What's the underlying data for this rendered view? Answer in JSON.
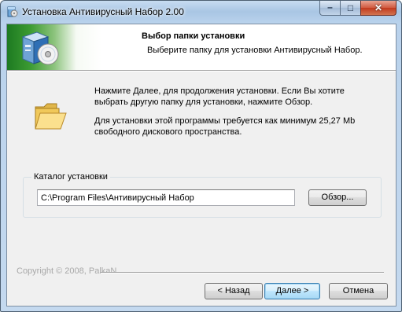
{
  "window": {
    "title": "Установка Антивирусный Набор 2.00",
    "minimize_glyph": "–",
    "maximize_glyph": "□",
    "close_glyph": "✕"
  },
  "header": {
    "title": "Выбор папки установки",
    "subtitle": "Выберите папку для установки Антивирусный Набор."
  },
  "body": {
    "description": "Нажмите Далее, для продолжения установки. Если Вы хотите выбрать другую папку для установки, нажмите Обзор.",
    "space_info": "Для установки этой программы требуется как минимум 25,27 Mb свободного дискового пространства."
  },
  "directory": {
    "group_label": "Каталог установки",
    "path_value": "C:\\Program Files\\Антивирусный Набор",
    "browse_label": "Обзор..."
  },
  "footer": {
    "copyright": "Copyright © 2008, PalkaN",
    "back_label": "< Назад",
    "next_label": "Далее >",
    "cancel_label": "Отмена"
  },
  "icons": {
    "title": "installer-box-icon",
    "header": "installer-box-cd-icon",
    "folder": "folder-icon"
  }
}
